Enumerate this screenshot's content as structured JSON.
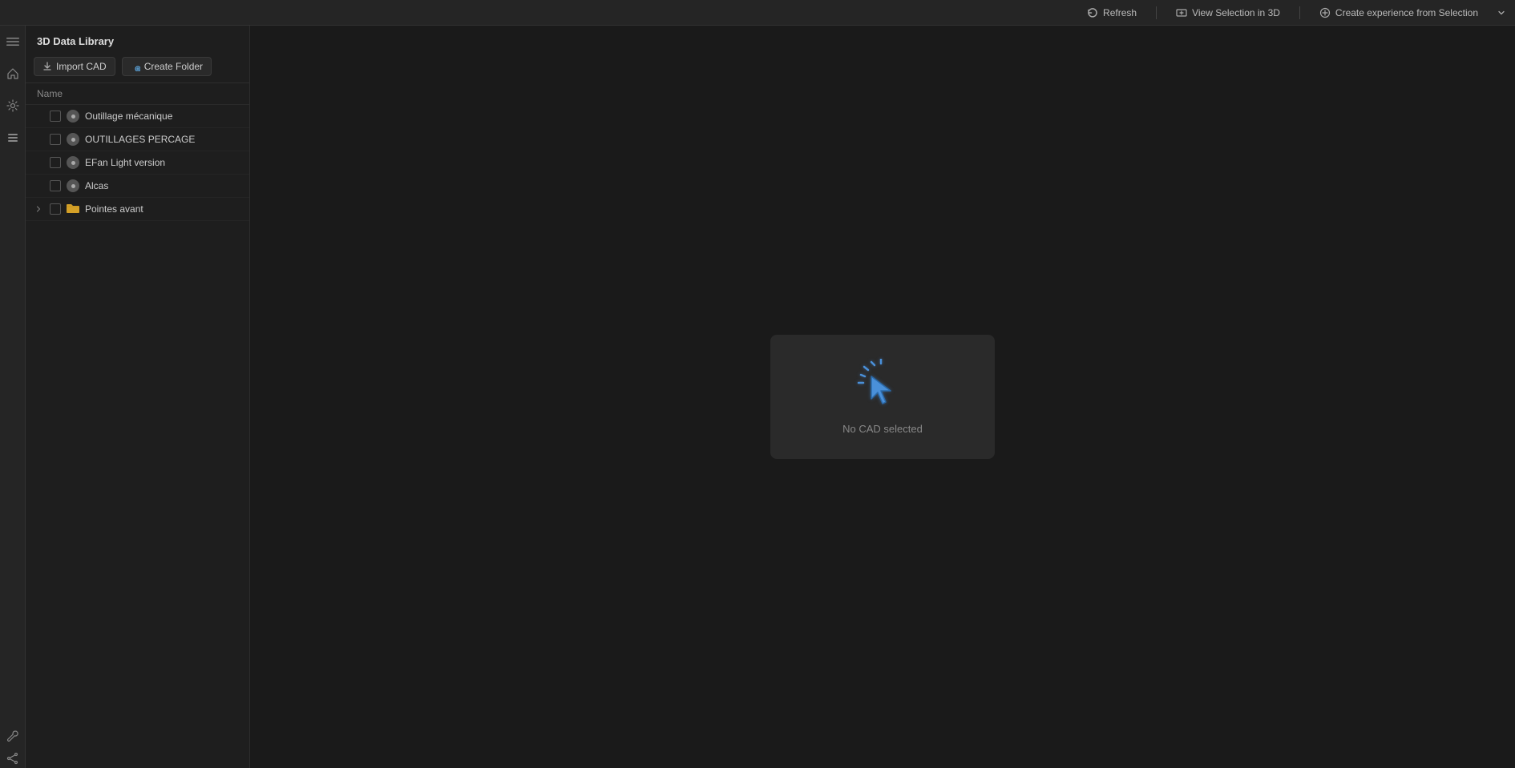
{
  "topbar": {
    "refresh_label": "Refresh",
    "view_selection_label": "View Selection in 3D",
    "create_experience_label": "Create experience from Selection"
  },
  "panel": {
    "title": "3D Data Library",
    "import_cad_label": "Import CAD",
    "create_folder_label": "Create Folder",
    "name_column": "Name",
    "files": [
      {
        "id": 1,
        "name": "Outillage mécanique",
        "type": "cad",
        "expandable": false
      },
      {
        "id": 2,
        "name": "OUTILLAGES PERCAGE",
        "type": "cad",
        "expandable": false
      },
      {
        "id": 3,
        "name": "EFan Light version",
        "type": "cad",
        "expandable": false
      },
      {
        "id": 4,
        "name": "Alcas",
        "type": "cad",
        "expandable": false
      },
      {
        "id": 5,
        "name": "Pointes avant",
        "type": "folder",
        "expandable": true
      }
    ]
  },
  "preview": {
    "no_cad_text": "No CAD selected"
  },
  "sidebar_icons": {
    "menu_icon": "≡",
    "home_icon": "⌂",
    "settings_icon": "⚙",
    "list_icon": "☰",
    "tools_icon": "🔧",
    "info_icon": "ℹ"
  }
}
